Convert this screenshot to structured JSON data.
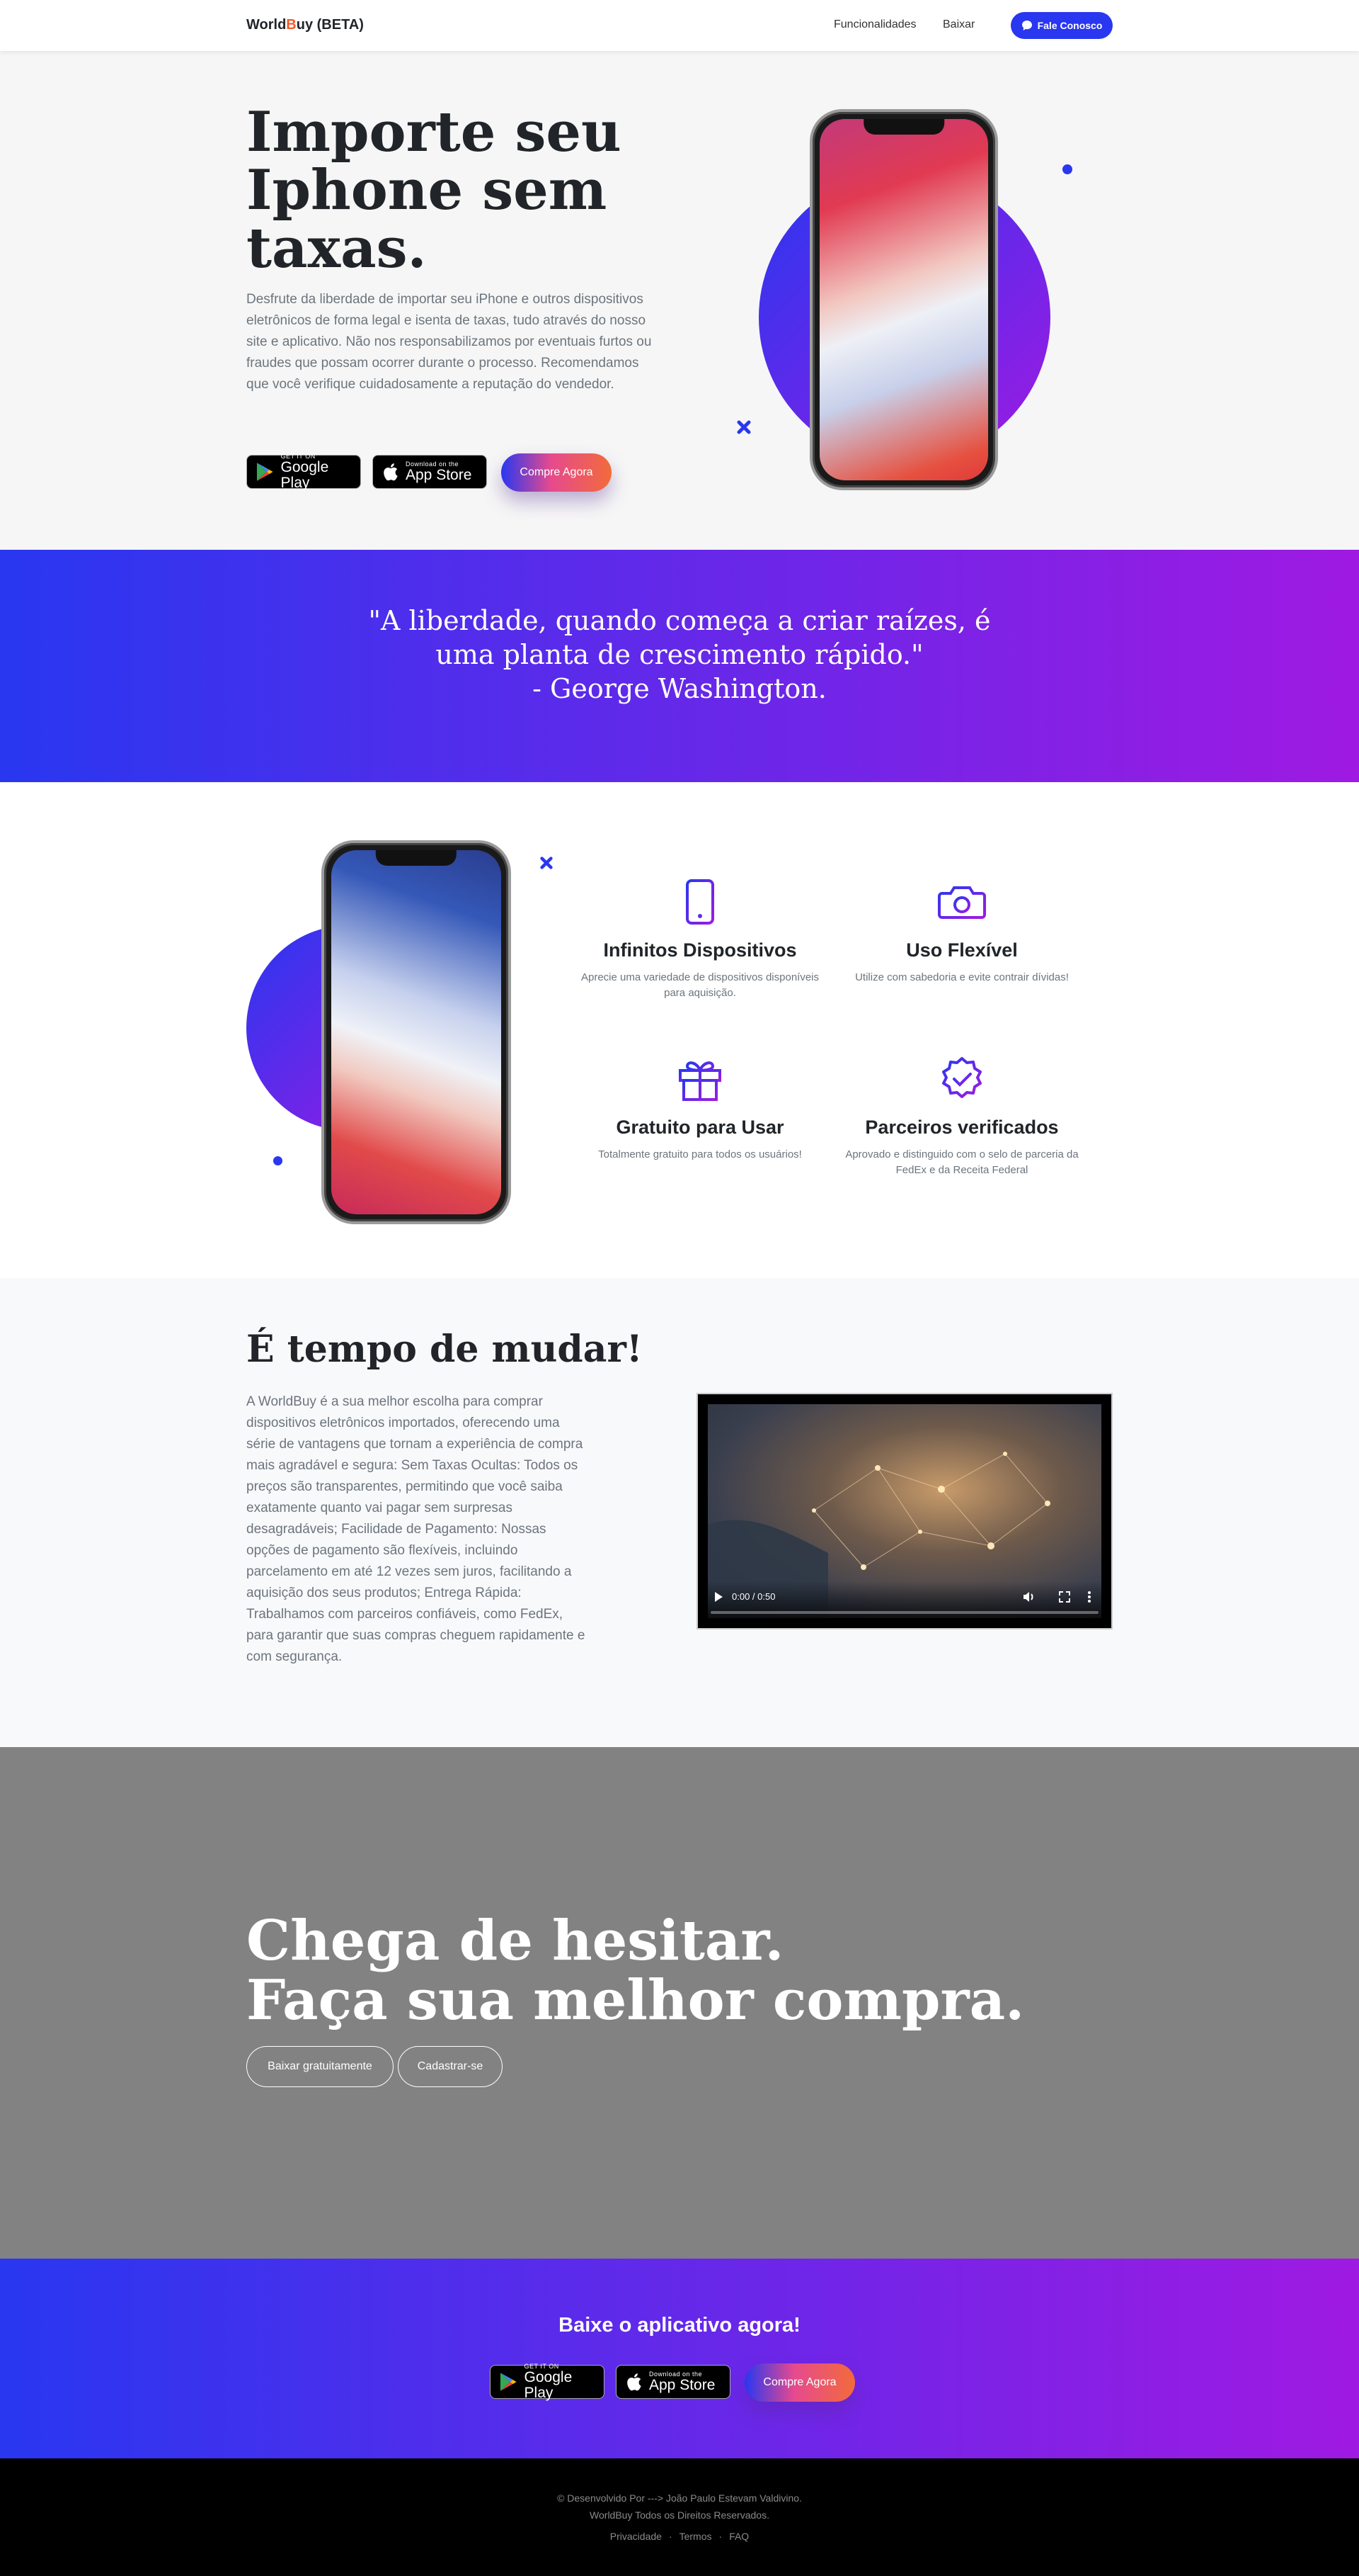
{
  "nav": {
    "brand_prefix": "World",
    "brand_b": "B",
    "brand_suffix": "uy (BETA)",
    "link_features": "Funcionalidades",
    "link_download": "Baixar",
    "contact_button": "Fale Conosco"
  },
  "hero": {
    "title": "Importe seu Iphone sem taxas.",
    "text": "Desfrute da liberdade de importar seu iPhone e outros dispositivos eletrônicos de forma legal e isenta de taxas, tudo através do nosso site e aplicativo. Não nos responsabilizamos por eventuais furtos ou fraudes que possam ocorrer durante o processo. Recomendamos que você verifique cuidadosamente a reputação do vendedor.",
    "google_play_small": "GET IT ON",
    "google_play_big": "Google Play",
    "app_store_small": "Download on the",
    "app_store_big": "App Store",
    "buy_button": "Compre Agora"
  },
  "quote": {
    "line1": "\"A liberdade, quando começa a criar raízes, é",
    "line2": "uma planta de crescimento rápido.\"",
    "line3": "- George Washington."
  },
  "features": [
    {
      "icon": "phone-icon",
      "title": "Infinitos Dispositivos",
      "text": "Aprecie uma variedade de dispositivos disponíveis para aquisição."
    },
    {
      "icon": "camera-icon",
      "title": "Uso Flexível",
      "text": "Utilize com sabedoria e evite contrair dívidas!"
    },
    {
      "icon": "gift-icon",
      "title": "Gratuito para Usar",
      "text": "Totalmente gratuito para todos os usuários!"
    },
    {
      "icon": "verified-badge-icon",
      "title": "Parceiros verificados",
      "text": "Aprovado e distinguido com o selo de parceria da FedEx e da Receita Federal"
    }
  ],
  "change": {
    "title": "É tempo de mudar!",
    "text": "A WorldBuy é a sua melhor escolha para comprar dispositivos eletrônicos importados, oferecendo uma série de vantagens que tornam a experiência de compra mais agradável e segura: Sem Taxas Ocultas: Todos os preços são transparentes, permitindo que você saiba exatamente quanto vai pagar sem surpresas desagradáveis; Facilidade de Pagamento: Nossas opções de pagamento são flexíveis, incluindo parcelamento em até 12 vezes sem juros, facilitando a aquisição dos seus produtos; Entrega Rápida: Trabalhamos com parceiros confiáveis, como FedEx, para garantir que suas compras cheguem rapidamente e com segurança.",
    "video_time": "0:00 / 0:50",
    "video_progress": 0
  },
  "cta": {
    "line1": "Chega de hesitar.",
    "line2": "Faça sua melhor compra.",
    "download_free": "Baixar gratuitamente",
    "signup": "Cadastrar-se"
  },
  "download": {
    "title": "Baixe o aplicativo agora!",
    "buy_button": "Compre Agora"
  },
  "footer": {
    "line1": "© Desenvolvido Por ---> João Paulo Estevam Valdivino.",
    "line2": "WorldBuy Todos os Direitos Reservados.",
    "privacy": "Privacidade",
    "sep": "·",
    "terms": "Termos",
    "faq": "FAQ"
  },
  "colors": {
    "primary": "#2937f0",
    "secondary": "#9f1ae2",
    "accent_orange": "#f26b3a",
    "cta_gray": "#828282"
  }
}
